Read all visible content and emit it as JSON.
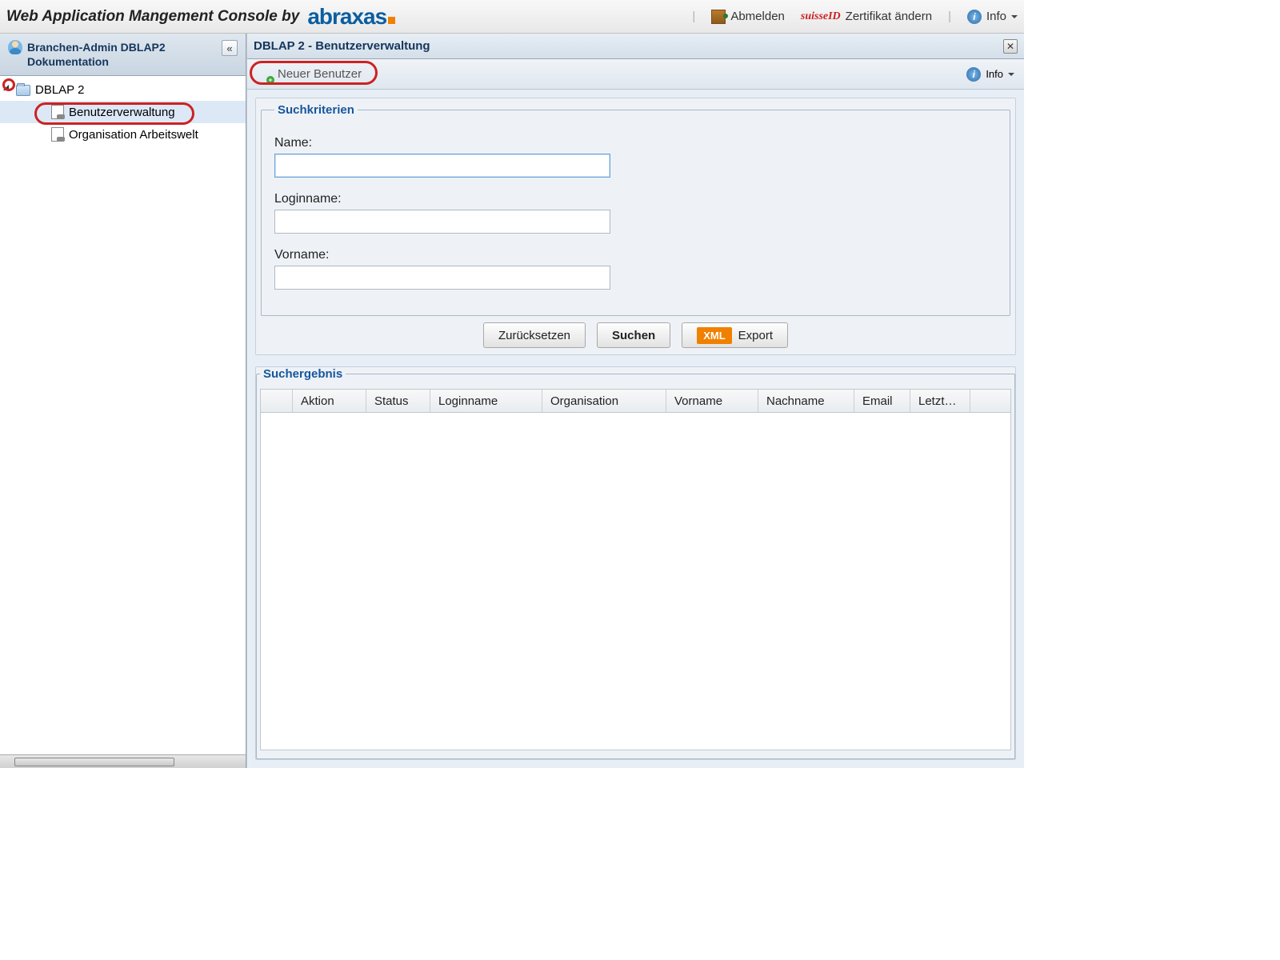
{
  "topbar": {
    "title": "Web Application Mangement Console by",
    "brand": "abraxas",
    "logout": "Abmelden",
    "suisseid": "suisseID",
    "cert_change": "Zertifikat ändern",
    "info": "Info"
  },
  "sidebar": {
    "header_line1": "Branchen-Admin DBLAP2",
    "header_line2": "Dokumentation",
    "tree": {
      "root": "DBLAP 2",
      "child1": "Benutzerverwaltung",
      "child2": "Organisation Arbeitswelt"
    }
  },
  "main": {
    "title": "DBLAP 2 - Benutzerverwaltung",
    "new_user": "Neuer Benutzer",
    "info": "Info",
    "search_criteria_legend": "Suchkriterien",
    "fields": {
      "name_label": "Name:",
      "login_label": "Loginname:",
      "firstname_label": "Vorname:"
    },
    "buttons": {
      "reset": "Zurücksetzen",
      "search": "Suchen",
      "xml": "XML",
      "export": "Export"
    },
    "results_legend": "Suchergebnis",
    "columns": [
      "",
      "Aktion",
      "Status",
      "Loginname",
      "Organisation",
      "Vorname",
      "Nachname",
      "Email",
      "Letzt…"
    ]
  }
}
